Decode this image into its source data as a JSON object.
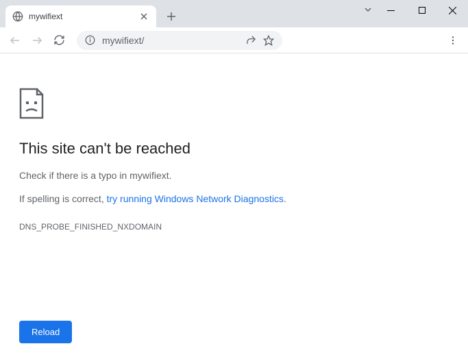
{
  "tab": {
    "title": "mywifiext"
  },
  "address": {
    "url": "mywifiext/"
  },
  "error": {
    "heading": "This site can't be reached",
    "subtext": "Check if there is a typo in mywifiext.",
    "suggestion_prefix": "If spelling is correct, ",
    "suggestion_link": "try running Windows Network Diagnostics",
    "suggestion_suffix": ".",
    "code": "DNS_PROBE_FINISHED_NXDOMAIN",
    "reload_label": "Reload"
  }
}
